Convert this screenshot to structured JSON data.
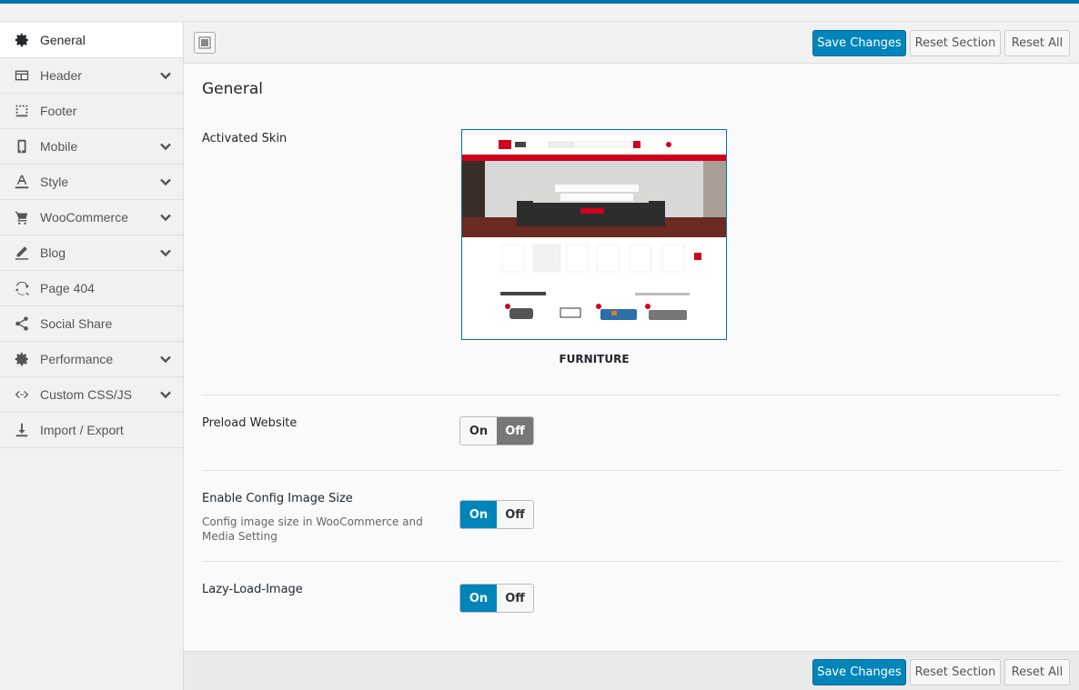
{
  "colors": {
    "accent": "#0085ba",
    "accent_dark": "#006799",
    "topbar": "#0073aa"
  },
  "sidebar": {
    "items": [
      {
        "label": "General",
        "icon": "gear-icon",
        "active": true
      },
      {
        "label": "Header",
        "icon": "header-icon",
        "expandable": true
      },
      {
        "label": "Footer",
        "icon": "footer-icon"
      },
      {
        "label": "Mobile",
        "icon": "mobile-icon",
        "expandable": true
      },
      {
        "label": "Style",
        "icon": "text-style-icon",
        "expandable": true
      },
      {
        "label": "WooCommerce",
        "icon": "cart-icon",
        "expandable": true
      },
      {
        "label": "Blog",
        "icon": "pencil-icon",
        "expandable": true
      },
      {
        "label": "Page 404",
        "icon": "refresh-search-icon"
      },
      {
        "label": "Social Share",
        "icon": "share-icon"
      },
      {
        "label": "Performance",
        "icon": "gears-icon",
        "expandable": true
      },
      {
        "label": "Custom CSS/JS",
        "icon": "code-icon",
        "expandable": true
      },
      {
        "label": "Import / Export",
        "icon": "download-icon"
      }
    ]
  },
  "toolbar": {
    "save_label": "Save Changes",
    "reset_section_label": "Reset Section",
    "reset_all_label": "Reset All"
  },
  "main": {
    "title": "General",
    "activated_skin": {
      "label": "Activated Skin",
      "skin_name": "FURNITURE"
    },
    "preload": {
      "label": "Preload Website",
      "on_label": "On",
      "off_label": "Off",
      "value": "Off"
    },
    "config_image": {
      "label": "Enable Config Image Size",
      "description": "Config image size in WooCommerce and Media Setting",
      "on_label": "On",
      "off_label": "Off",
      "value": "On"
    },
    "lazy_load": {
      "label": "Lazy-Load-Image",
      "on_label": "On",
      "off_label": "Off",
      "value": "On"
    }
  }
}
